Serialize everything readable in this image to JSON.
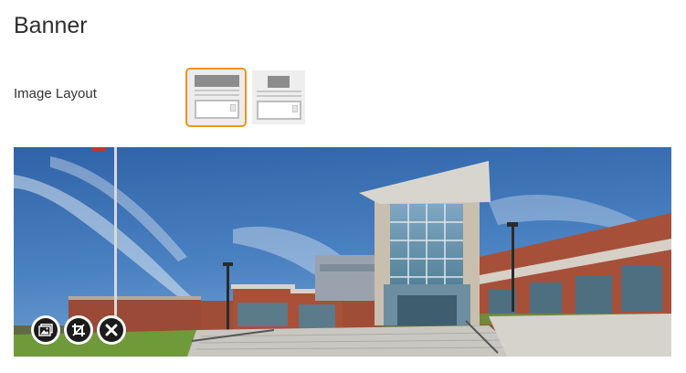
{
  "heading": "Banner",
  "image_layout": {
    "label": "Image Layout",
    "options": [
      {
        "name": "full-width-banner-layout",
        "selected": true
      },
      {
        "name": "centered-banner-layout",
        "selected": false
      }
    ]
  },
  "banner_image": {
    "description_icon": "school-building-photo"
  },
  "image_actions": [
    {
      "name": "image-icon",
      "action": "change image"
    },
    {
      "name": "crop-icon",
      "action": "crop image"
    },
    {
      "name": "close-icon",
      "action": "remove image"
    }
  ],
  "colors": {
    "accent": "#f0941e",
    "sky": "#3d74b8",
    "brick": "#a24a34"
  }
}
